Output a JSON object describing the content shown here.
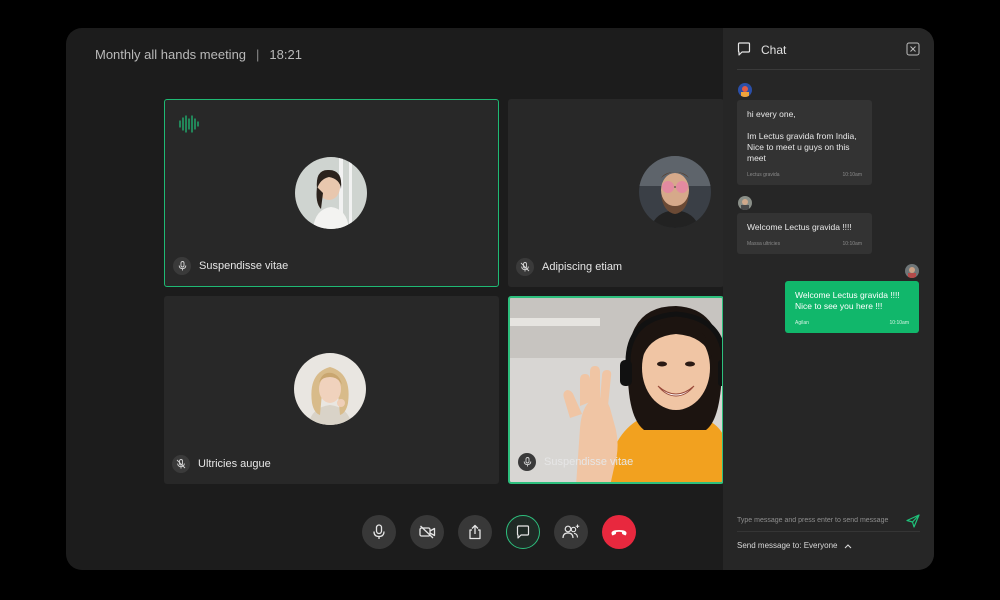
{
  "meeting": {
    "title": "Monthly all hands meeting",
    "separator": "|",
    "time": "18:21"
  },
  "participants": [
    {
      "name": "Suspendisse vitae",
      "mic": "on",
      "speaking": true
    },
    {
      "name": "Adipiscing etiam",
      "mic": "muted",
      "speaking": false
    },
    {
      "name": "Ultricies augue",
      "mic": "muted",
      "speaking": false
    },
    {
      "name": "Suspendisse vitae",
      "mic": "on",
      "speaking": false,
      "video": true
    }
  ],
  "controls": {
    "icons": [
      "microphone-icon",
      "video-off-icon",
      "share-icon",
      "chat-icon",
      "participants-icon",
      "end-call-icon"
    ]
  },
  "chat": {
    "title": "Chat",
    "messages": [
      {
        "text": "hi every one,\n\nIm Lectus gravida from India,\nNice to meet u guys on this\nmeet",
        "sender": "Lectus gravida",
        "time": "10:10am"
      },
      {
        "text": "Welcome Lectus gravida !!!!",
        "sender": "Massa ultricies",
        "time": "10:10am"
      },
      {
        "text": "Welcome Lectus gravida !!!!\nNice to see you here !!!",
        "sender": "Agilan",
        "time": "10:10am"
      }
    ],
    "input_placeholder": "Type message and press enter to send message",
    "send_to_label": "Send message to: Everyone"
  },
  "colors": {
    "accent": "#11b76b",
    "end_call": "#e8283e"
  }
}
